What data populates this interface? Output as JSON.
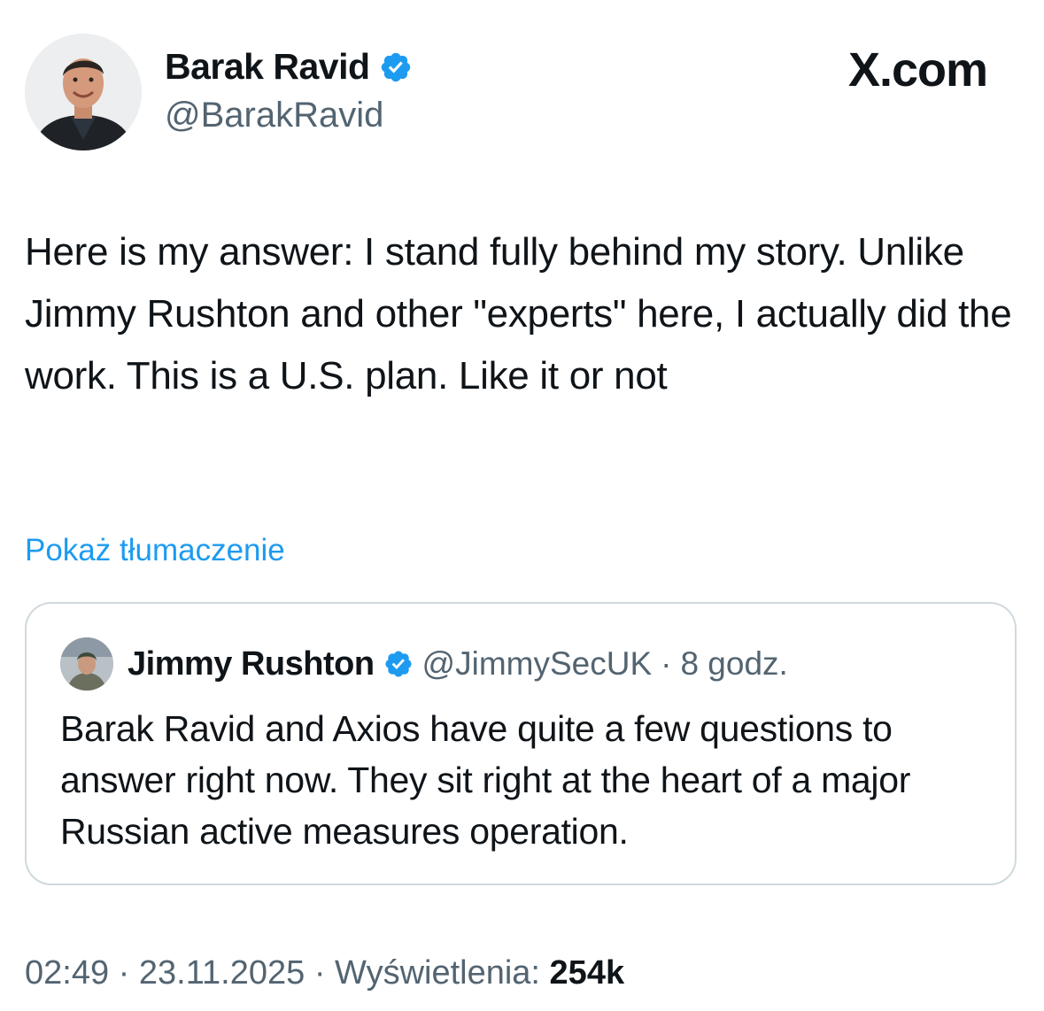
{
  "brand": {
    "label": "X.com"
  },
  "author": {
    "name": "Barak Ravid",
    "handle": "@BarakRavid",
    "verified": true
  },
  "tweet": {
    "text": "Here is my answer: I stand fully behind my story. Unlike Jimmy Rushton and other \"experts\" here, I actually did the work. This is a U.S. plan. Like it or not",
    "translate_label": "Pokaż tłumaczenie"
  },
  "quote": {
    "name": "Jimmy Rushton",
    "handle": "@JimmySecUK",
    "separator": "·",
    "time": "8 godz.",
    "verified": true,
    "text": "Barak Ravid and Axios have quite a few questions to answer right now. They sit right at the heart of a major Russian active measures operation."
  },
  "meta": {
    "time": "02:49",
    "separator": "·",
    "date": "23.11.2025",
    "views_label": "Wyświetlenia:",
    "views_count": "254k"
  },
  "colors": {
    "text": "#0f1419",
    "secondary": "#536471",
    "link": "#1d9bf0",
    "verified": "#1d9bf0",
    "border": "#cfd9de"
  },
  "icons": {
    "verified": "verified-badge-icon",
    "avatar": "profile-photo",
    "brand": "x-logo"
  }
}
